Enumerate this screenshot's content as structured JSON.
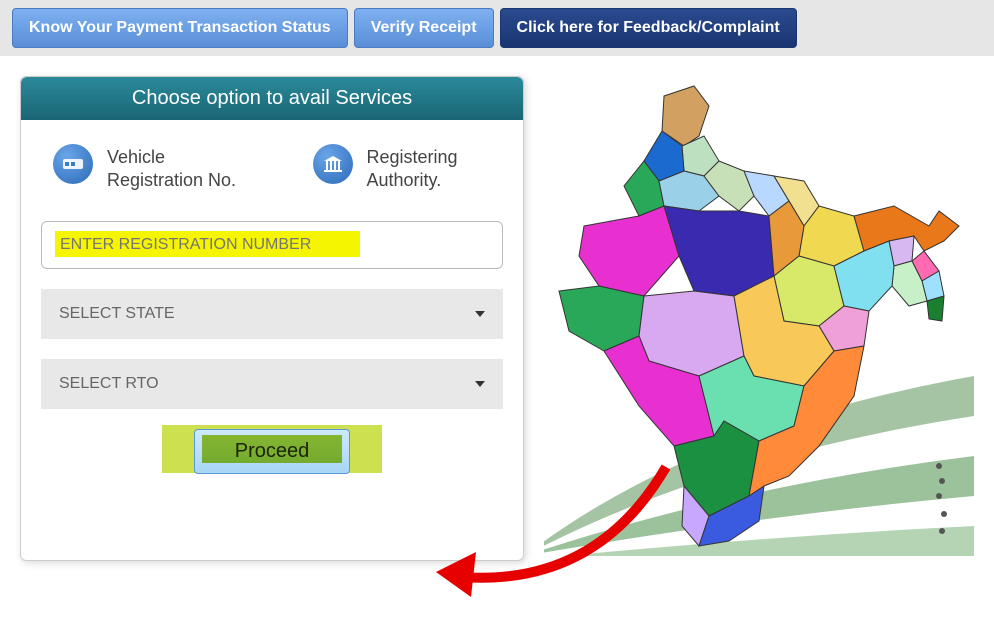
{
  "topbar": {
    "payment_status": "Know Your Payment Transaction Status",
    "verify_receipt": "Verify Receipt",
    "feedback": "Click here for Feedback/Complaint"
  },
  "panel": {
    "header": "Choose option to avail Services",
    "option_vehicle": "Vehicle Registration No.",
    "option_authority": "Registering Authority.",
    "reg_placeholder": "ENTER REGISTRATION NUMBER",
    "select_state": "SELECT STATE",
    "select_rto": "SELECT RTO",
    "proceed": "Proceed"
  }
}
